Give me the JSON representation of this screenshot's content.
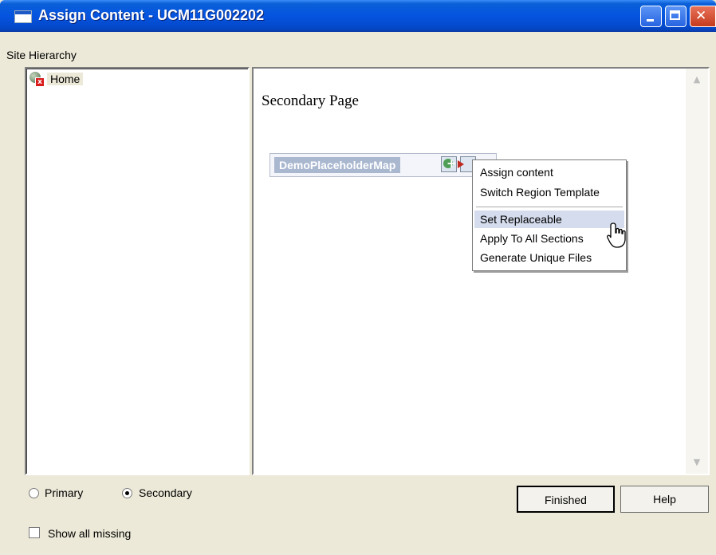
{
  "window": {
    "title": "Assign Content - UCM11G002202"
  },
  "sidebar": {
    "heading": "Site Hierarchy",
    "items": [
      {
        "label": "Home",
        "icon": "site-home-icon"
      }
    ]
  },
  "main": {
    "page_heading": "Secondary Page",
    "placeholder": {
      "label": "DemoPlaceholderMap",
      "icons": [
        "add-content-icon",
        "region-menu-icon"
      ]
    }
  },
  "context_menu": {
    "items": [
      {
        "label": "Assign content"
      },
      {
        "label": "Switch Region Template"
      },
      {
        "label": "Set Replaceable",
        "highlighted": true
      },
      {
        "label": "Apply To All Sections"
      },
      {
        "label": "Generate Unique Files"
      }
    ]
  },
  "footer": {
    "radio_primary": "Primary",
    "radio_secondary": "Secondary",
    "selected_radio": "Secondary",
    "show_missing": "Show all missing",
    "show_missing_checked": false,
    "finished_button": "Finished",
    "help_button": "Help"
  }
}
